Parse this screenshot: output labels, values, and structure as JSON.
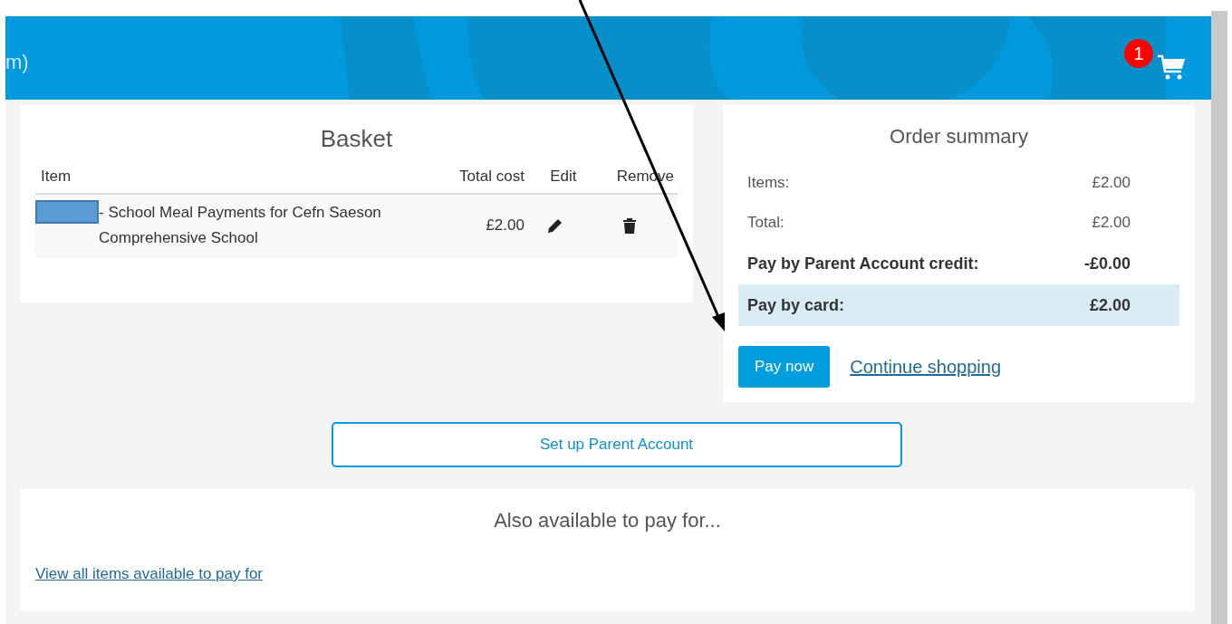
{
  "header": {
    "title_fragment": "m)",
    "cart": {
      "count": "1"
    }
  },
  "basket": {
    "title": "Basket",
    "columns": [
      "Item",
      "Total cost",
      "Edit",
      "Remove"
    ],
    "rows": [
      {
        "redacted": true,
        "item": "- School Meal Payments for Cefn Saeson Comprehensive School",
        "total": "£2.00"
      }
    ]
  },
  "order_summary": {
    "title": "Order summary",
    "lines": [
      {
        "label": "Items:",
        "value": "£2.00",
        "kind": "plain"
      },
      {
        "label": "Total:",
        "value": "£2.00",
        "kind": "plain"
      },
      {
        "label": "Pay by Parent Account credit:",
        "value": "-£0.00",
        "kind": "bold"
      },
      {
        "label": "Pay by card:",
        "value": "£2.00",
        "kind": "highlight"
      }
    ],
    "pay_button": "Pay now",
    "continue_link": "Continue shopping"
  },
  "setup_button": "Set up Parent Account",
  "also_available": {
    "title": "Also available to pay for...",
    "link": "View all items available to pay for"
  }
}
